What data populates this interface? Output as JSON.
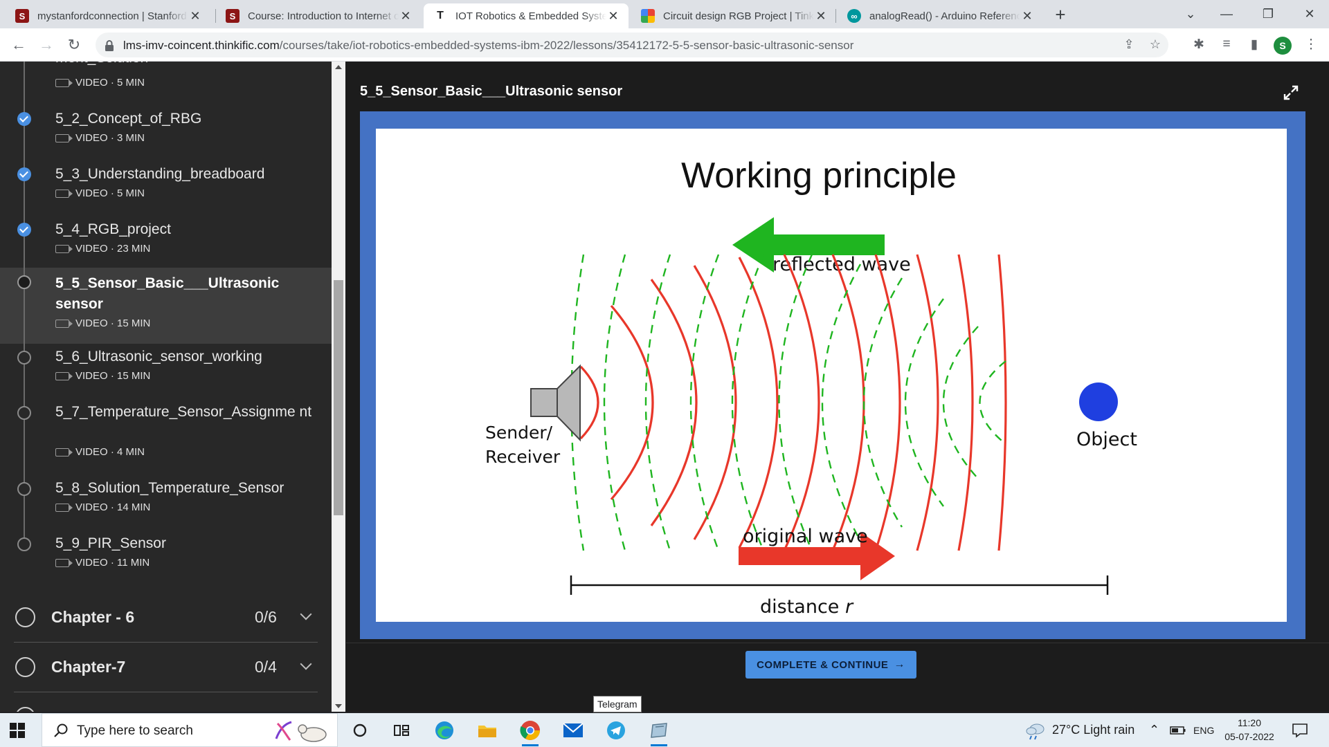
{
  "browser": {
    "tabs": [
      {
        "title": "mystanfordconnection | Stanford",
        "fav": "S",
        "fav_color": "#8c1515",
        "active": false
      },
      {
        "title": "Course: Introduction to Internet of",
        "fav": "S",
        "fav_color": "#8c1515",
        "active": false
      },
      {
        "title": "IOT Robotics & Embedded Systems",
        "fav": "T",
        "fav_color": "#ffffff",
        "active": true
      },
      {
        "title": "Circuit design RGB Project | Tinkercad",
        "fav": "",
        "fav_color": "#e8a317",
        "active": false
      },
      {
        "title": "analogRead() - Arduino Reference",
        "fav": "∞",
        "fav_color": "#00979d",
        "active": false
      }
    ],
    "tab_close": "✕",
    "newtab": "+",
    "url_host": "lms-imv-coincent.thinkific.com",
    "url_path": "/courses/take/iot-robotics-embedded-systems-ibm-2022/lessons/35412172-5-5-sensor-basic-ultrasonic-sensor",
    "profile_initial": "S",
    "icons": [
      "back-icon",
      "forward-icon",
      "reload-icon",
      "lock-icon",
      "share-icon",
      "star-icon",
      "extensions-icon",
      "reading-list-icon",
      "side-panel-icon",
      "menu-icon"
    ]
  },
  "sidebar": {
    "lessons": [
      {
        "name": "ment_Solution",
        "meta": "VIDEO · 5 MIN",
        "status": "done"
      },
      {
        "name": "5_2_Concept_of_RBG",
        "meta": "VIDEO · 3 MIN",
        "status": "done"
      },
      {
        "name": "5_3_Understanding_breadboard",
        "meta": "VIDEO · 5 MIN",
        "status": "done"
      },
      {
        "name": "5_4_RGB_project",
        "meta": "VIDEO · 23 MIN",
        "status": "done"
      },
      {
        "name": "5_5_Sensor_Basic___Ultrasonic sensor",
        "meta": "VIDEO · 15 MIN",
        "status": "current"
      },
      {
        "name": "5_6_Ultrasonic_sensor_working",
        "meta": "VIDEO · 15 MIN",
        "status": "todo"
      },
      {
        "name": "5_7_Temperature_Sensor_Assignme nt",
        "meta": "VIDEO · 4 MIN",
        "status": "todo"
      },
      {
        "name": "5_8_Solution_Temperature_Sensor",
        "meta": "VIDEO · 14 MIN",
        "status": "todo"
      },
      {
        "name": "5_9_PIR_Sensor",
        "meta": "VIDEO · 11 MIN",
        "status": "todo"
      }
    ],
    "chapters": [
      {
        "name": "Chapter - 6",
        "count": "0/6"
      },
      {
        "name": "Chapter-7",
        "count": "0/4"
      }
    ]
  },
  "content": {
    "title": "5_5_Sensor_Basic___Ultrasonic sensor",
    "slide": {
      "heading": "Working principle",
      "reflected": "reflected wave",
      "original": "original wave",
      "sender_line1": "Sender/",
      "sender_line2": "Receiver",
      "object": "Object",
      "distance": "distance",
      "distance_var": "r",
      "colors": {
        "red": "#e8372a",
        "green": "#1fb520",
        "object": "#1f3fe0",
        "frame": "#4472c4"
      }
    },
    "complete_button": "COMPLETE & CONTINUE",
    "complete_arrow": "→"
  },
  "tooltip": "Telegram",
  "taskbar": {
    "search_placeholder": "Type here to search",
    "weather": "27°C  Light rain",
    "lang": "ENG",
    "time": "11:20",
    "date": "05-07-2022",
    "apps": [
      "cortana-icon",
      "task-view-icon",
      "edge-icon",
      "file-explorer-icon",
      "chrome-icon",
      "mail-icon",
      "telegram-icon",
      "app-icon"
    ]
  }
}
